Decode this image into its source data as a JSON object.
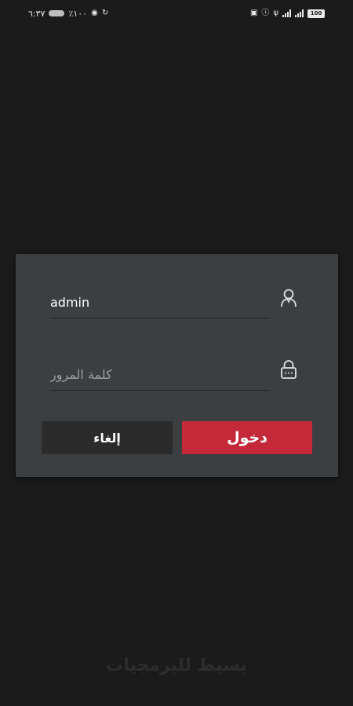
{
  "status_bar": {
    "time": "٦:٣٧",
    "notif_text": "٪١٠٠",
    "battery": "100"
  },
  "login": {
    "username_value": "admin",
    "password_placeholder": "كلمة المرور",
    "login_label": "دخول",
    "cancel_label": "إلغاء"
  },
  "icons": {
    "user": "user-icon",
    "lock": "lock-icon"
  },
  "colors": {
    "background": "#1b1b1b",
    "dialog": "#3b3f42",
    "login_button": "#c4293a",
    "cancel_button": "#2b2b2b"
  },
  "footer": {
    "brand": "بسيط للبرمجيات"
  }
}
